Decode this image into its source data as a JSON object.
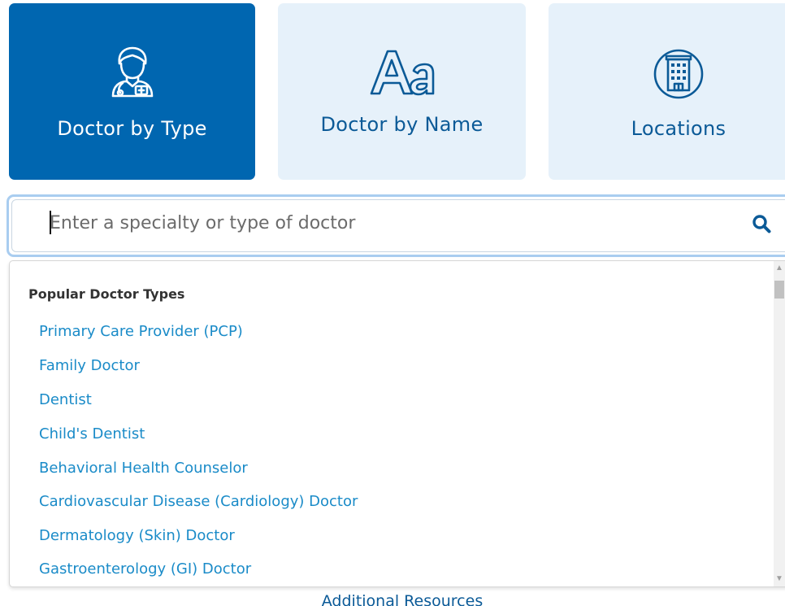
{
  "tabs": {
    "doctor_by_type": {
      "label": "Doctor by Type",
      "icon": "doctor-icon",
      "active": true
    },
    "doctor_by_name": {
      "label": "Doctor by Name",
      "icon": "text-aa-icon",
      "active": false
    },
    "locations": {
      "label": "Locations",
      "icon": "building-icon",
      "active": false
    }
  },
  "search": {
    "placeholder": "Enter a specialty or type of doctor",
    "value": "",
    "button_icon": "search-icon"
  },
  "dropdown": {
    "heading": "Popular Doctor Types",
    "items": [
      "Primary Care Provider (PCP)",
      "Family Doctor",
      "Dentist",
      "Child's Dentist",
      "Behavioral Health Counselor",
      "Cardiovascular Disease (Cardiology) Doctor",
      "Dermatology (Skin) Doctor",
      "Gastroenterology (GI) Doctor"
    ]
  },
  "footer": {
    "additional_resources": "Additional Resources"
  },
  "colors": {
    "active_tile": "#0066b0",
    "inactive_tile": "#e6f1fa",
    "link": "#1a8bc8",
    "focus_ring": "#a9cdf0"
  }
}
